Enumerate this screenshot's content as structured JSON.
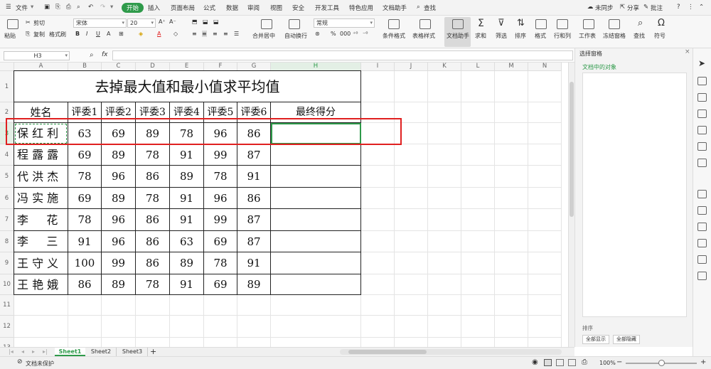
{
  "menu": {
    "file": "文件",
    "tabs": [
      "开始",
      "插入",
      "页面布局",
      "公式",
      "数据",
      "审阅",
      "视图",
      "安全",
      "开发工具",
      "特色应用",
      "文档助手"
    ],
    "active_tab": "开始",
    "search": "查找",
    "sync": "未同步",
    "share": "分享",
    "comment": "批注"
  },
  "ribbon": {
    "paste": "粘贴",
    "cut": "剪切",
    "copy": "复制",
    "format_painter": "格式刷",
    "font_name": "宋体",
    "font_size": "20",
    "merge_center": "合并居中",
    "wrap_text": "自动换行",
    "number_format": "常规",
    "cond_format": "条件格式",
    "table_style": "表格样式",
    "doc_assistant": "文档助手",
    "sum": "求和",
    "filter": "筛选",
    "sort": "排序",
    "format": "格式",
    "row_col": "行和列",
    "worksheet": "工作表",
    "freeze": "冻结窗格",
    "find": "查找",
    "symbol": "符号",
    "bold": "B",
    "italic": "I",
    "underline": "U",
    "percent": "%",
    "thousands": "000"
  },
  "formula_bar": {
    "cell_ref": "H3",
    "fx": "fx",
    "value": ""
  },
  "columns": [
    "A",
    "B",
    "C",
    "D",
    "E",
    "F",
    "G",
    "H",
    "I",
    "J",
    "K",
    "L",
    "M",
    "N"
  ],
  "rows": [
    "1",
    "2",
    "3",
    "4",
    "5",
    "6",
    "7",
    "8",
    "9",
    "10",
    "11",
    "12",
    "13",
    "14"
  ],
  "table": {
    "title": "去掉最大值和最小值求平均值",
    "headers": [
      "姓名",
      "评委1",
      "评委2",
      "评委3",
      "评委4",
      "评委5",
      "评委6",
      "最终得分"
    ],
    "data": [
      [
        "保 红 利",
        "63",
        "69",
        "89",
        "78",
        "96",
        "86",
        ""
      ],
      [
        "程 露 露",
        "69",
        "89",
        "78",
        "91",
        "99",
        "87",
        ""
      ],
      [
        "代 洪 杰",
        "78",
        "96",
        "86",
        "89",
        "78",
        "91",
        ""
      ],
      [
        "冯 实 施",
        "69",
        "89",
        "78",
        "91",
        "96",
        "86",
        ""
      ],
      [
        "李     花",
        "78",
        "96",
        "86",
        "91",
        "99",
        "87",
        ""
      ],
      [
        "李     三",
        "91",
        "96",
        "86",
        "63",
        "69",
        "87",
        ""
      ],
      [
        "王 守 义",
        "100",
        "99",
        "86",
        "89",
        "78",
        "91",
        ""
      ],
      [
        "王 艳 娥",
        "86",
        "89",
        "78",
        "91",
        "69",
        "89",
        ""
      ]
    ]
  },
  "pane": {
    "title": "选择窗格",
    "subtitle": "文档中的对象",
    "show_all": "全部显示",
    "hide_all": "全部隐藏",
    "label": "排序"
  },
  "sheets": [
    "Sheet1",
    "Sheet2",
    "Sheet3"
  ],
  "active_sheet": "Sheet1",
  "add_sheet": "+",
  "status": {
    "protection": "文档未保护",
    "zoom": "100%"
  },
  "colors": {
    "accent": "#2e9a4a",
    "highlight_box": "#e02020",
    "selection": "#2e9a4a"
  }
}
